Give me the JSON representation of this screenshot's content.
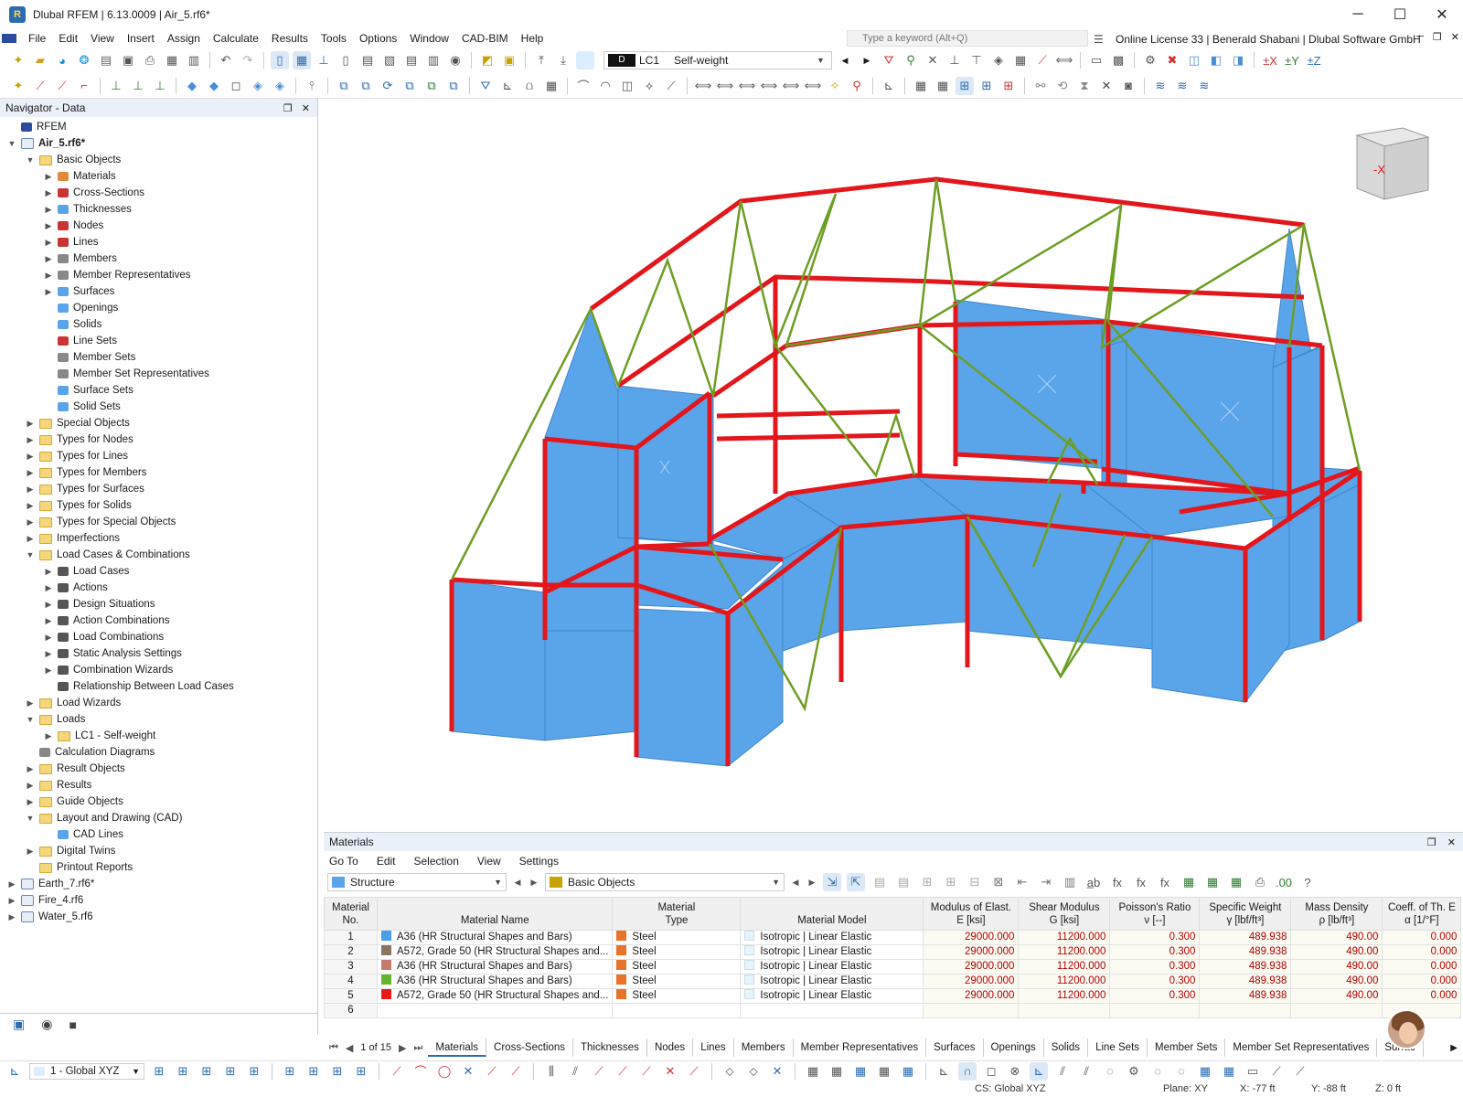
{
  "window": {
    "title": "Dlubal RFEM | 6.13.0009 | Air_5.rf6*"
  },
  "menu": [
    "File",
    "Edit",
    "View",
    "Insert",
    "Assign",
    "Calculate",
    "Results",
    "Tools",
    "Options",
    "Window",
    "CAD-BIM",
    "Help"
  ],
  "search": {
    "placeholder": "Type a keyword (Alt+Q)"
  },
  "license": "Online License 33 | Benerald Shabani | Dlubal Software GmbH",
  "loadcase": {
    "type": "D",
    "id": "LC1",
    "name": "Self-weight"
  },
  "navigator": {
    "title": "Navigator - Data",
    "tree": [
      {
        "level": 0,
        "label": "RFEM",
        "toggle": "",
        "icon": "app"
      },
      {
        "level": 0,
        "label": "Air_5.rf6*",
        "toggle": "v",
        "icon": "file",
        "bold": true
      },
      {
        "level": 1,
        "label": "Basic Objects",
        "toggle": "v",
        "icon": "folder"
      },
      {
        "level": 2,
        "label": "Materials",
        "toggle": ">",
        "icon": "materials"
      },
      {
        "level": 2,
        "label": "Cross-Sections",
        "toggle": ">",
        "icon": "cross-sections"
      },
      {
        "level": 2,
        "label": "Thicknesses",
        "toggle": ">",
        "icon": "thicknesses"
      },
      {
        "level": 2,
        "label": "Nodes",
        "toggle": ">",
        "icon": "nodes"
      },
      {
        "level": 2,
        "label": "Lines",
        "toggle": ">",
        "icon": "lines"
      },
      {
        "level": 2,
        "label": "Members",
        "toggle": ">",
        "icon": "members"
      },
      {
        "level": 2,
        "label": "Member Representatives",
        "toggle": ">",
        "icon": "member-representatives"
      },
      {
        "level": 2,
        "label": "Surfaces",
        "toggle": ">",
        "icon": "surfaces"
      },
      {
        "level": 2,
        "label": "Openings",
        "toggle": "",
        "icon": "openings"
      },
      {
        "level": 2,
        "label": "Solids",
        "toggle": "",
        "icon": "solids"
      },
      {
        "level": 2,
        "label": "Line Sets",
        "toggle": "",
        "icon": "line-sets"
      },
      {
        "level": 2,
        "label": "Member Sets",
        "toggle": "",
        "icon": "member-sets"
      },
      {
        "level": 2,
        "label": "Member Set Representatives",
        "toggle": "",
        "icon": "member-set-representatives"
      },
      {
        "level": 2,
        "label": "Surface Sets",
        "toggle": "",
        "icon": "surface-sets"
      },
      {
        "level": 2,
        "label": "Solid Sets",
        "toggle": "",
        "icon": "solid-sets"
      },
      {
        "level": 1,
        "label": "Special Objects",
        "toggle": ">",
        "icon": "folder"
      },
      {
        "level": 1,
        "label": "Types for Nodes",
        "toggle": ">",
        "icon": "folder"
      },
      {
        "level": 1,
        "label": "Types for Lines",
        "toggle": ">",
        "icon": "folder"
      },
      {
        "level": 1,
        "label": "Types for Members",
        "toggle": ">",
        "icon": "folder"
      },
      {
        "level": 1,
        "label": "Types for Surfaces",
        "toggle": ">",
        "icon": "folder"
      },
      {
        "level": 1,
        "label": "Types for Solids",
        "toggle": ">",
        "icon": "folder"
      },
      {
        "level": 1,
        "label": "Types for Special Objects",
        "toggle": ">",
        "icon": "folder"
      },
      {
        "level": 1,
        "label": "Imperfections",
        "toggle": ">",
        "icon": "folder"
      },
      {
        "level": 1,
        "label": "Load Cases & Combinations",
        "toggle": "v",
        "icon": "folder"
      },
      {
        "level": 2,
        "label": "Load Cases",
        "toggle": ">",
        "icon": "load-cases"
      },
      {
        "level": 2,
        "label": "Actions",
        "toggle": ">",
        "icon": "actions"
      },
      {
        "level": 2,
        "label": "Design Situations",
        "toggle": ">",
        "icon": "design-situations"
      },
      {
        "level": 2,
        "label": "Action Combinations",
        "toggle": ">",
        "icon": "action-combinations"
      },
      {
        "level": 2,
        "label": "Load Combinations",
        "toggle": ">",
        "icon": "load-combinations"
      },
      {
        "level": 2,
        "label": "Static Analysis Settings",
        "toggle": ">",
        "icon": "static-analysis-settings"
      },
      {
        "level": 2,
        "label": "Combination Wizards",
        "toggle": ">",
        "icon": "combination-wizards"
      },
      {
        "level": 2,
        "label": "Relationship Between Load Cases",
        "toggle": "",
        "icon": "relationship"
      },
      {
        "level": 1,
        "label": "Load Wizards",
        "toggle": ">",
        "icon": "folder"
      },
      {
        "level": 1,
        "label": "Loads",
        "toggle": "v",
        "icon": "folder"
      },
      {
        "level": 2,
        "label": "LC1 - Self-weight",
        "toggle": ">",
        "icon": "folder"
      },
      {
        "level": 1,
        "label": "Calculation Diagrams",
        "toggle": "",
        "icon": "calculation-diagrams"
      },
      {
        "level": 1,
        "label": "Result Objects",
        "toggle": ">",
        "icon": "folder"
      },
      {
        "level": 1,
        "label": "Results",
        "toggle": ">",
        "icon": "folder"
      },
      {
        "level": 1,
        "label": "Guide Objects",
        "toggle": ">",
        "icon": "folder"
      },
      {
        "level": 1,
        "label": "Layout and Drawing (CAD)",
        "toggle": "v",
        "icon": "folder"
      },
      {
        "level": 2,
        "label": "CAD Lines",
        "toggle": "",
        "icon": "cad-lines"
      },
      {
        "level": 1,
        "label": "Digital Twins",
        "toggle": ">",
        "icon": "folder"
      },
      {
        "level": 1,
        "label": "Printout Reports",
        "toggle": "",
        "icon": "folder"
      },
      {
        "level": 0,
        "label": "Earth_7.rf6*",
        "toggle": ">",
        "icon": "file"
      },
      {
        "level": 0,
        "label": "Fire_4.rf6",
        "toggle": ">",
        "icon": "file"
      },
      {
        "level": 0,
        "label": "Water_5.rf6",
        "toggle": ">",
        "icon": "file"
      }
    ]
  },
  "viewport": {
    "navcube_label": "-X"
  },
  "materials_panel": {
    "title": "Materials",
    "menu": [
      "Go To",
      "Edit",
      "Selection",
      "View",
      "Settings"
    ],
    "structure_combo": "Structure",
    "objects_combo": "Basic Objects",
    "columns": [
      {
        "line1": "Material",
        "line2": "No."
      },
      {
        "line1": "",
        "line2": "Material Name"
      },
      {
        "line1": "Material",
        "line2": "Type"
      },
      {
        "line1": "",
        "line2": "Material Model"
      },
      {
        "line1": "Modulus of Elast.",
        "line2": "E [ksi]"
      },
      {
        "line1": "Shear Modulus",
        "line2": "G [ksi]"
      },
      {
        "line1": "Poisson's Ratio",
        "line2": "ν [--]"
      },
      {
        "line1": "Specific Weight",
        "line2": "γ [lbf/ft³]"
      },
      {
        "line1": "Mass Density",
        "line2": "ρ [lb/ft³]"
      },
      {
        "line1": "Coeff. of Th. E",
        "line2": "α [1/°F]"
      }
    ],
    "rows": [
      {
        "no": "1",
        "name": "A36 (HR Structural Shapes and Bars)",
        "color": "#4a9fe8",
        "type": "Steel",
        "model": "Isotropic | Linear Elastic",
        "E": "29000.000",
        "G": "11200.000",
        "nu": "0.300",
        "gamma": "489.938",
        "rho": "490.00",
        "alpha": "0.000"
      },
      {
        "no": "2",
        "name": "A572, Grade 50 (HR Structural Shapes and...",
        "color": "#8a7560",
        "type": "Steel",
        "model": "Isotropic | Linear Elastic",
        "E": "29000.000",
        "G": "11200.000",
        "nu": "0.300",
        "gamma": "489.938",
        "rho": "490.00",
        "alpha": "0.000"
      },
      {
        "no": "3",
        "name": "A36 (HR Structural Shapes and Bars)",
        "color": "#c67a6e",
        "type": "Steel",
        "model": "Isotropic | Linear Elastic",
        "E": "29000.000",
        "G": "11200.000",
        "nu": "0.300",
        "gamma": "489.938",
        "rho": "490.00",
        "alpha": "0.000"
      },
      {
        "no": "4",
        "name": "A36 (HR Structural Shapes and Bars)",
        "color": "#66b32e",
        "type": "Steel",
        "model": "Isotropic | Linear Elastic",
        "E": "29000.000",
        "G": "11200.000",
        "nu": "0.300",
        "gamma": "489.938",
        "rho": "490.00",
        "alpha": "0.000"
      },
      {
        "no": "5",
        "name": "A572, Grade 50 (HR Structural Shapes and...",
        "color": "#e81a1a",
        "type": "Steel",
        "model": "Isotropic | Linear Elastic",
        "E": "29000.000",
        "G": "11200.000",
        "nu": "0.300",
        "gamma": "489.938",
        "rho": "490.00",
        "alpha": "0.000"
      },
      {
        "no": "6",
        "name": "",
        "color": "",
        "type": "",
        "model": "",
        "E": "",
        "G": "",
        "nu": "",
        "gamma": "",
        "rho": "",
        "alpha": ""
      }
    ],
    "steel_color": "#e8742a",
    "pager": "1 of 15",
    "tabs": [
      "Materials",
      "Cross-Sections",
      "Thicknesses",
      "Nodes",
      "Lines",
      "Members",
      "Member Representatives",
      "Surfaces",
      "Openings",
      "Solids",
      "Line Sets",
      "Member Sets",
      "Member Set Representatives",
      "Surfac"
    ]
  },
  "bottom_toolbar": {
    "view_combo": "1 - Global XYZ"
  },
  "status": {
    "cs": "CS: Global XYZ",
    "plane": "Plane: XY",
    "x": "X: -77 ft",
    "y": "Y: -88 ft",
    "z": "Z: 0 ft"
  }
}
